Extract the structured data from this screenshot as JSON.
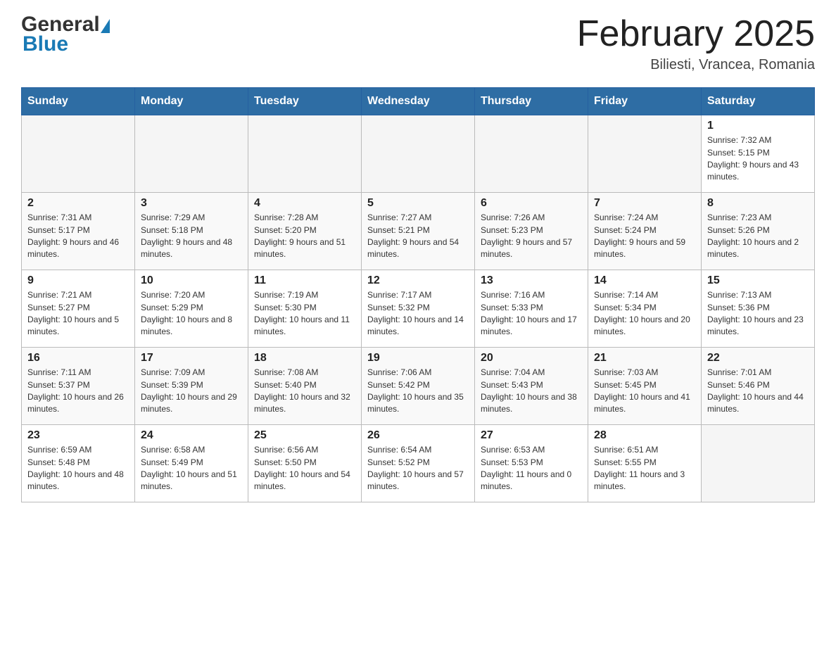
{
  "header": {
    "month_title": "February 2025",
    "location": "Biliesti, Vrancea, Romania",
    "logo_general": "General",
    "logo_blue": "Blue"
  },
  "weekdays": [
    "Sunday",
    "Monday",
    "Tuesday",
    "Wednesday",
    "Thursday",
    "Friday",
    "Saturday"
  ],
  "weeks": [
    [
      {
        "day": "",
        "info": ""
      },
      {
        "day": "",
        "info": ""
      },
      {
        "day": "",
        "info": ""
      },
      {
        "day": "",
        "info": ""
      },
      {
        "day": "",
        "info": ""
      },
      {
        "day": "",
        "info": ""
      },
      {
        "day": "1",
        "info": "Sunrise: 7:32 AM\nSunset: 5:15 PM\nDaylight: 9 hours and 43 minutes."
      }
    ],
    [
      {
        "day": "2",
        "info": "Sunrise: 7:31 AM\nSunset: 5:17 PM\nDaylight: 9 hours and 46 minutes."
      },
      {
        "day": "3",
        "info": "Sunrise: 7:29 AM\nSunset: 5:18 PM\nDaylight: 9 hours and 48 minutes."
      },
      {
        "day": "4",
        "info": "Sunrise: 7:28 AM\nSunset: 5:20 PM\nDaylight: 9 hours and 51 minutes."
      },
      {
        "day": "5",
        "info": "Sunrise: 7:27 AM\nSunset: 5:21 PM\nDaylight: 9 hours and 54 minutes."
      },
      {
        "day": "6",
        "info": "Sunrise: 7:26 AM\nSunset: 5:23 PM\nDaylight: 9 hours and 57 minutes."
      },
      {
        "day": "7",
        "info": "Sunrise: 7:24 AM\nSunset: 5:24 PM\nDaylight: 9 hours and 59 minutes."
      },
      {
        "day": "8",
        "info": "Sunrise: 7:23 AM\nSunset: 5:26 PM\nDaylight: 10 hours and 2 minutes."
      }
    ],
    [
      {
        "day": "9",
        "info": "Sunrise: 7:21 AM\nSunset: 5:27 PM\nDaylight: 10 hours and 5 minutes."
      },
      {
        "day": "10",
        "info": "Sunrise: 7:20 AM\nSunset: 5:29 PM\nDaylight: 10 hours and 8 minutes."
      },
      {
        "day": "11",
        "info": "Sunrise: 7:19 AM\nSunset: 5:30 PM\nDaylight: 10 hours and 11 minutes."
      },
      {
        "day": "12",
        "info": "Sunrise: 7:17 AM\nSunset: 5:32 PM\nDaylight: 10 hours and 14 minutes."
      },
      {
        "day": "13",
        "info": "Sunrise: 7:16 AM\nSunset: 5:33 PM\nDaylight: 10 hours and 17 minutes."
      },
      {
        "day": "14",
        "info": "Sunrise: 7:14 AM\nSunset: 5:34 PM\nDaylight: 10 hours and 20 minutes."
      },
      {
        "day": "15",
        "info": "Sunrise: 7:13 AM\nSunset: 5:36 PM\nDaylight: 10 hours and 23 minutes."
      }
    ],
    [
      {
        "day": "16",
        "info": "Sunrise: 7:11 AM\nSunset: 5:37 PM\nDaylight: 10 hours and 26 minutes."
      },
      {
        "day": "17",
        "info": "Sunrise: 7:09 AM\nSunset: 5:39 PM\nDaylight: 10 hours and 29 minutes."
      },
      {
        "day": "18",
        "info": "Sunrise: 7:08 AM\nSunset: 5:40 PM\nDaylight: 10 hours and 32 minutes."
      },
      {
        "day": "19",
        "info": "Sunrise: 7:06 AM\nSunset: 5:42 PM\nDaylight: 10 hours and 35 minutes."
      },
      {
        "day": "20",
        "info": "Sunrise: 7:04 AM\nSunset: 5:43 PM\nDaylight: 10 hours and 38 minutes."
      },
      {
        "day": "21",
        "info": "Sunrise: 7:03 AM\nSunset: 5:45 PM\nDaylight: 10 hours and 41 minutes."
      },
      {
        "day": "22",
        "info": "Sunrise: 7:01 AM\nSunset: 5:46 PM\nDaylight: 10 hours and 44 minutes."
      }
    ],
    [
      {
        "day": "23",
        "info": "Sunrise: 6:59 AM\nSunset: 5:48 PM\nDaylight: 10 hours and 48 minutes."
      },
      {
        "day": "24",
        "info": "Sunrise: 6:58 AM\nSunset: 5:49 PM\nDaylight: 10 hours and 51 minutes."
      },
      {
        "day": "25",
        "info": "Sunrise: 6:56 AM\nSunset: 5:50 PM\nDaylight: 10 hours and 54 minutes."
      },
      {
        "day": "26",
        "info": "Sunrise: 6:54 AM\nSunset: 5:52 PM\nDaylight: 10 hours and 57 minutes."
      },
      {
        "day": "27",
        "info": "Sunrise: 6:53 AM\nSunset: 5:53 PM\nDaylight: 11 hours and 0 minutes."
      },
      {
        "day": "28",
        "info": "Sunrise: 6:51 AM\nSunset: 5:55 PM\nDaylight: 11 hours and 3 minutes."
      },
      {
        "day": "",
        "info": ""
      }
    ]
  ]
}
